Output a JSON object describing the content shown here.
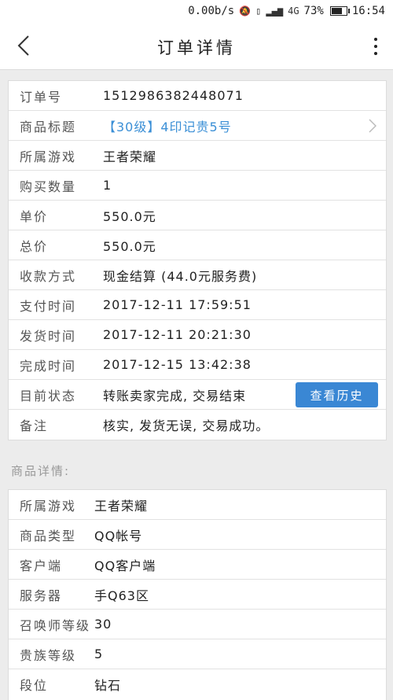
{
  "status_bar": {
    "speed": "0.00b/s",
    "icons": [
      "mute-icon",
      "vibrate-icon",
      "signal-icon",
      "4g-icon"
    ],
    "network": "4G",
    "battery": "73%",
    "battery_level": 0.73,
    "time": "16:54"
  },
  "nav": {
    "title": "订单详情"
  },
  "order": {
    "rows": [
      {
        "label": "订单号",
        "value": "1512986382448071"
      },
      {
        "label": "商品标题",
        "value": "【30级】4印记贵5号"
      },
      {
        "label": "所属游戏",
        "value": "王者荣耀"
      },
      {
        "label": "购买数量",
        "value": "1"
      },
      {
        "label": "单价",
        "value": "550.0元"
      },
      {
        "label": "总价",
        "value": "550.0元"
      },
      {
        "label": "收款方式",
        "value": "现金结算 (44.0元服务费)"
      },
      {
        "label": "支付时间",
        "value": "2017-12-11 17:59:51"
      },
      {
        "label": "发货时间",
        "value": "2017-12-11 20:21:30"
      },
      {
        "label": "完成时间",
        "value": "2017-12-15 13:42:38"
      },
      {
        "label": "目前状态",
        "value": "转账卖家完成, 交易结束"
      },
      {
        "label": "备注",
        "value": "核实, 发货无误, 交易成功。"
      }
    ],
    "history_button": "查看历史"
  },
  "details": {
    "section_title": "商品详情:",
    "rows": [
      {
        "label": "所属游戏",
        "value": "王者荣耀"
      },
      {
        "label": "商品类型",
        "value": "QQ帐号"
      },
      {
        "label": "客户端",
        "value": "QQ客户端"
      },
      {
        "label": "服务器",
        "value": "手Q63区"
      },
      {
        "label": "召唤师等级",
        "value": "30"
      },
      {
        "label": "贵族等级",
        "value": "5"
      },
      {
        "label": "段位",
        "value": "钻石"
      }
    ]
  }
}
